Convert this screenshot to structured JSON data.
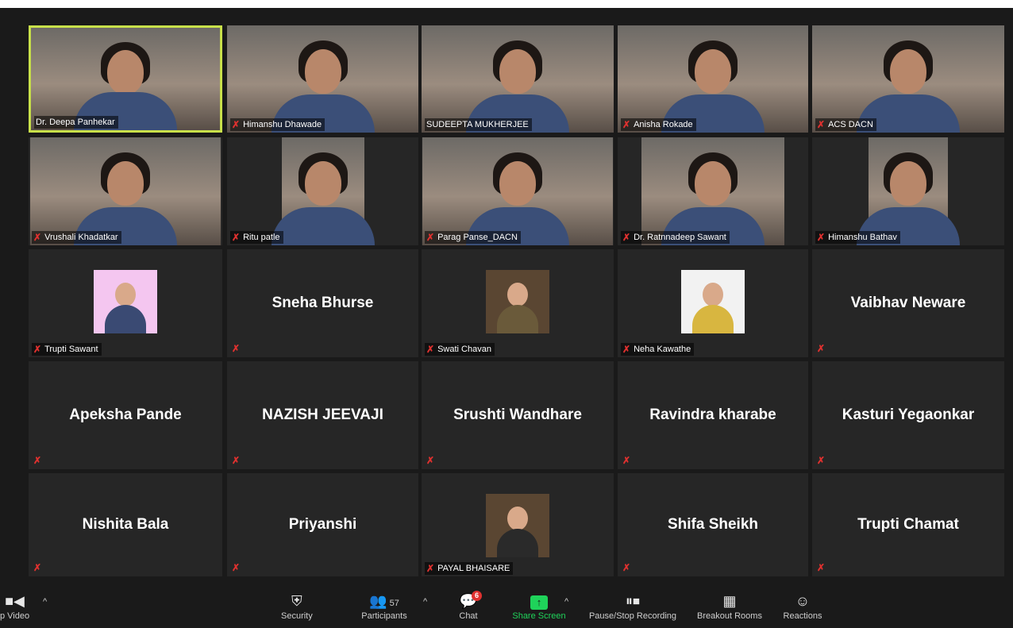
{
  "participants": [
    {
      "name": "Dr. Deepa Panhekar",
      "type": "video",
      "muted": false,
      "active": true
    },
    {
      "name": "Himanshu Dhawade",
      "type": "video",
      "muted": true
    },
    {
      "name": "SUDEEPTA MUKHERJEE",
      "type": "video",
      "muted": false
    },
    {
      "name": "Anisha Rokade",
      "type": "video",
      "muted": true
    },
    {
      "name": "ACS DACN",
      "type": "video",
      "muted": true
    },
    {
      "name": "Vrushali Khadatkar",
      "type": "video",
      "muted": true
    },
    {
      "name": "Ritu patle",
      "type": "video",
      "muted": true
    },
    {
      "name": "Parag Panse_DACN",
      "type": "video",
      "muted": true
    },
    {
      "name": "Dr. Ratnnadeep Sawant",
      "type": "video",
      "muted": true
    },
    {
      "name": "Himanshu Bathav",
      "type": "video",
      "muted": true
    },
    {
      "name": "Trupti Sawant",
      "type": "avatar",
      "muted": true
    },
    {
      "name": "Sneha Bhurse",
      "type": "name",
      "muted": true
    },
    {
      "name": "Swati Chavan",
      "type": "avatar",
      "muted": true
    },
    {
      "name": "Neha Kawathe",
      "type": "avatar",
      "muted": true
    },
    {
      "name": "Vaibhav Neware",
      "type": "name",
      "muted": true
    },
    {
      "name": "Apeksha Pande",
      "type": "name",
      "muted": true
    },
    {
      "name": "NAZISH JEEVAJI",
      "type": "name",
      "muted": true
    },
    {
      "name": "Srushti Wandhare",
      "type": "name",
      "muted": true
    },
    {
      "name": "Ravindra kharabe",
      "type": "name",
      "muted": true
    },
    {
      "name": "Kasturi Yegaonkar",
      "type": "name",
      "muted": true
    },
    {
      "name": "Nishita Bala",
      "type": "name",
      "muted": true
    },
    {
      "name": "Priyanshi",
      "type": "name",
      "muted": true
    },
    {
      "name": "PAYAL BHAISARE",
      "type": "avatar",
      "muted": true
    },
    {
      "name": "Shifa Sheikh",
      "type": "name",
      "muted": true
    },
    {
      "name": "Trupti  Chamat",
      "type": "name",
      "muted": true
    }
  ],
  "toolbar": {
    "video_label": "p Video",
    "security_label": "Security",
    "participants_label": "Participants",
    "participants_count": "57",
    "chat_label": "Chat",
    "chat_badge": "6",
    "share_label": "Share Screen",
    "record_label": "Pause/Stop Recording",
    "breakout_label": "Breakout Rooms",
    "reactions_label": "Reactions"
  },
  "colors": {
    "active_border": "#c8e04a",
    "mute_red": "#e0312f",
    "share_green": "#1fd35a"
  }
}
